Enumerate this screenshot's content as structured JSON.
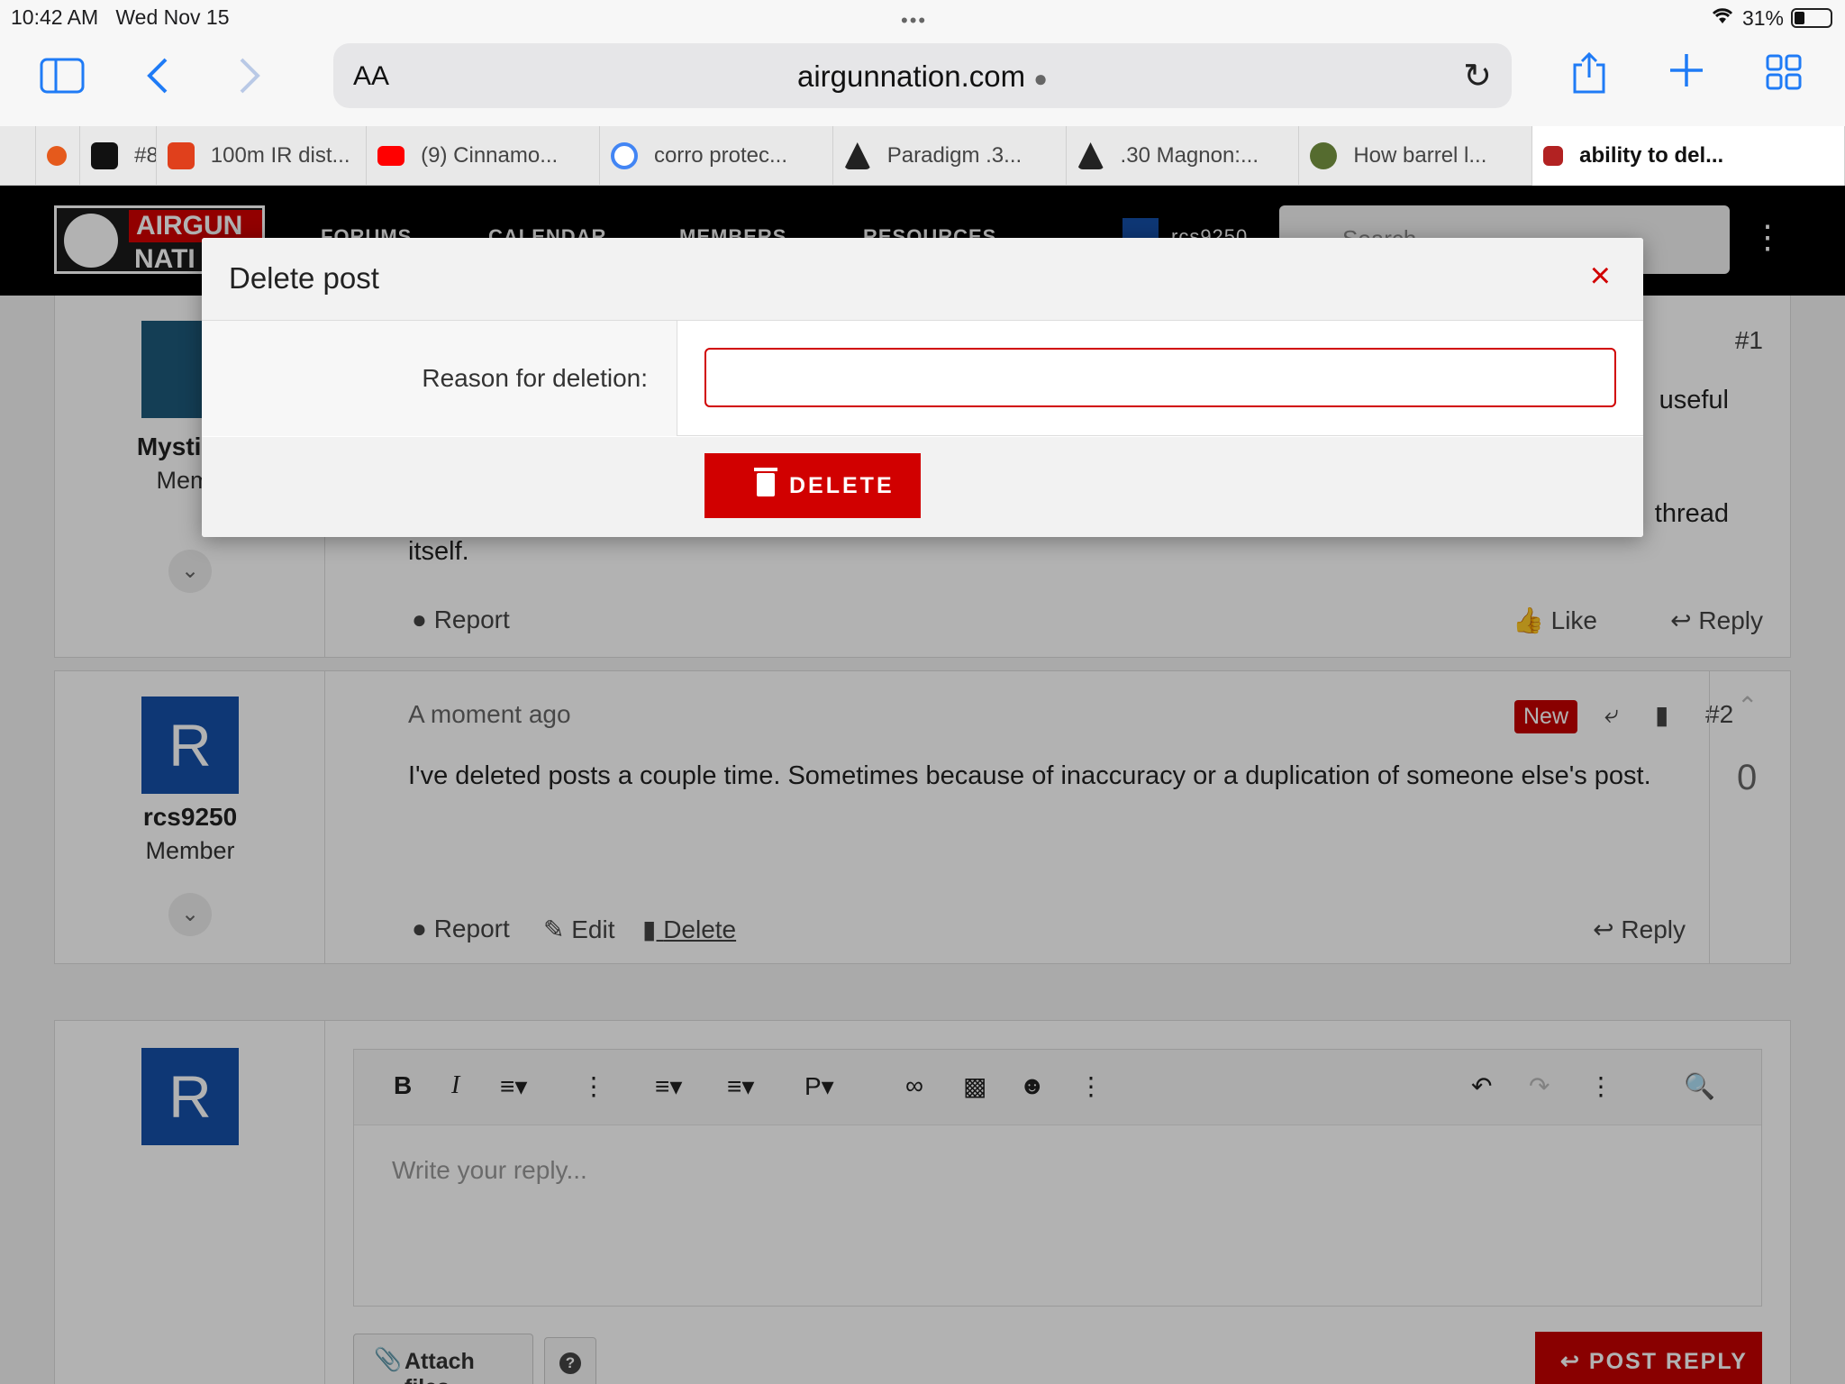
{
  "status_bar": {
    "time": "10:42 AM",
    "date": "Wed Nov 15",
    "battery": "31%"
  },
  "browser": {
    "url": "airgunnation.com",
    "text_size_label": "AA",
    "tabs": [
      {
        "label": "",
        "color": "#e55a1c"
      },
      {
        "label": "#8",
        "color": "#111111"
      },
      {
        "label": "100m IR dist...",
        "color": "#e0401c"
      },
      {
        "label": "(9) Cinnamo...",
        "color": "#ff0000"
      },
      {
        "label": "corro protec...",
        "color": "#4285f4"
      },
      {
        "label": "Paradigm .3...",
        "color": "#222222"
      },
      {
        "label": ".30 Magnon:...",
        "color": "#222222"
      },
      {
        "label": "How barrel l...",
        "color": "#556b2f"
      },
      {
        "label": "ability to del...",
        "color": "#b22222"
      }
    ]
  },
  "site_nav": {
    "logo_line1": "AIRGUN",
    "logo_line2": "NATI",
    "items": [
      "FORUMS",
      "CALENDAR",
      "MEMBERS",
      "RESOURCES"
    ],
    "user": "rcs9250",
    "search_placeholder": "Search"
  },
  "posts": [
    {
      "username": "Mysticall",
      "role": "Memb",
      "number": "#1",
      "text_fragments": [
        "useful",
        "thread",
        "itself."
      ],
      "actions": {
        "report": "Report",
        "like": "Like",
        "reply": "Reply"
      }
    },
    {
      "username": "rcs9250",
      "role": "Member",
      "avatar_letter": "R",
      "time": "A moment ago",
      "badge": "New",
      "number": "#2",
      "text": "I've deleted posts a couple time. Sometimes because of inaccuracy or a duplication of someone else's post.",
      "vote_count": "0",
      "actions": {
        "report": "Report",
        "edit": "Edit",
        "delete": "Delete",
        "reply": "Reply"
      }
    }
  ],
  "editor": {
    "avatar_letter": "R",
    "placeholder": "Write your reply...",
    "attach_label": "Attach files",
    "help_label": "?",
    "post_reply_label": "POST REPLY"
  },
  "modal": {
    "title": "Delete post",
    "close_symbol": "×",
    "reason_label": "Reason for deletion:",
    "reason_value": "",
    "delete_label": "DELETE",
    "accent_color": "#d10000"
  }
}
